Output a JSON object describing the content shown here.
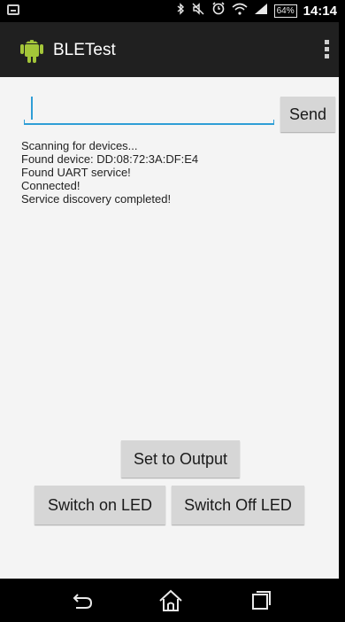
{
  "status_bar": {
    "battery": "64%",
    "time": "14:14",
    "icons": [
      "notification-icon",
      "bluetooth-icon",
      "mute-icon",
      "alarm-icon",
      "wifi-icon",
      "signal-icon"
    ]
  },
  "app": {
    "title": "BLETest",
    "logo_icon": "android-icon",
    "overflow_icon": "overflow-menu-icon"
  },
  "input": {
    "value": "",
    "placeholder": ""
  },
  "buttons": {
    "send": "Send",
    "set_output": "Set to Output",
    "switch_on": "Switch on LED",
    "switch_off": "Switch Off LED"
  },
  "log": [
    "Scanning for devices...",
    "Found device: DD:08:72:3A:DF:E4",
    "Found UART service!",
    "Connected!",
    "Service discovery completed!"
  ],
  "nav": [
    "back-icon",
    "home-icon",
    "recent-apps-icon"
  ],
  "colors": {
    "accent": "#2f9ed6",
    "android_green": "#a4c639",
    "action_bar": "#202020"
  }
}
